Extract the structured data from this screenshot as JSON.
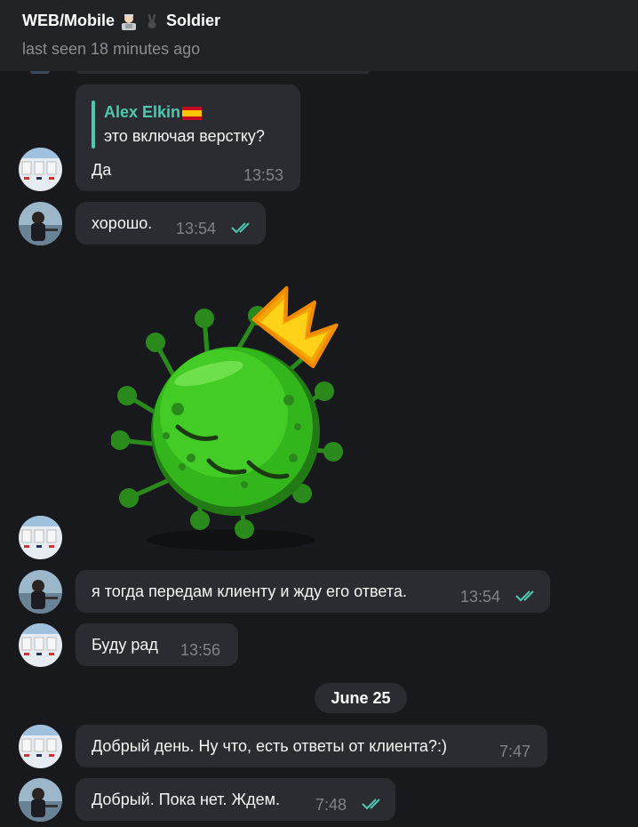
{
  "header": {
    "title_prefix": "WEB/Mobile",
    "title_suffix": "Soldier",
    "status": "last seen 18 minutes ago"
  },
  "messages": [
    {
      "reply_name": "Alex Elkin",
      "reply_text": "это включая верстку?",
      "text": "Да",
      "time": "13:53"
    },
    {
      "text": "хорошо.",
      "time": "13:54",
      "read": true
    },
    {
      "sticker": "green-virus-with-crown"
    },
    {
      "text": "я тогда передам клиенту и жду его ответа.",
      "time": "13:54",
      "read": true
    },
    {
      "text": "Буду рад",
      "time": "13:56"
    },
    {
      "text": "Добрый день. Ну что, есть ответы от клиента?:)",
      "time": "7:47"
    },
    {
      "text": "Добрый. Пока нет. Ждем.",
      "time": "7:48",
      "read": true
    }
  ],
  "date_separator": "June 25",
  "colors": {
    "accent": "#4ec9b0",
    "bubble": "#2b2c31",
    "background": "#18191d",
    "header": "#212226"
  }
}
